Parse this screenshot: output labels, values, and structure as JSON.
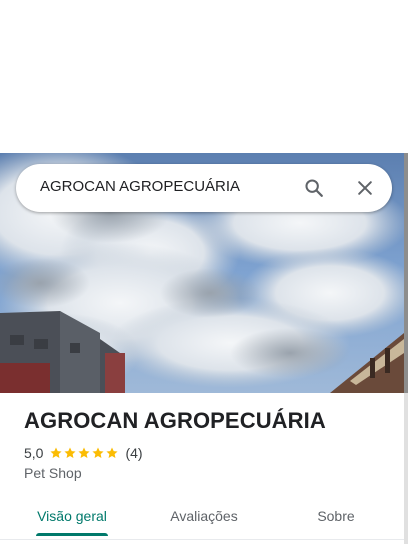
{
  "search": {
    "query": "AGROCAN AGROPECUÁRIA",
    "search_icon": "search-icon",
    "close_icon": "close-icon"
  },
  "place": {
    "name": "AGROCAN AGROPECUÁRIA",
    "rating": "5,0",
    "stars": 5,
    "reviews": "(4)",
    "category": "Pet Shop"
  },
  "tabs": [
    {
      "label": "Visão geral",
      "active": true
    },
    {
      "label": "Avaliações",
      "active": false
    },
    {
      "label": "Sobre",
      "active": false
    }
  ],
  "colors": {
    "accent": "#00796b",
    "star": "#fbbc04",
    "text": "#202124",
    "muted": "#5f6368"
  }
}
